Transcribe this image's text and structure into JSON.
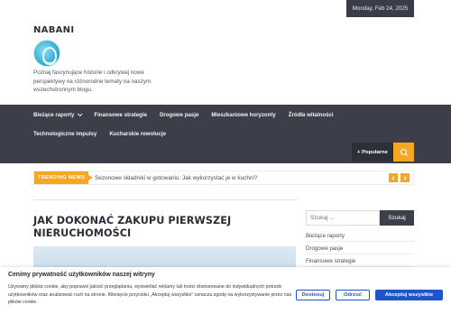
{
  "topbar": {
    "date": "Monday, Feb 24, 2025"
  },
  "header": {
    "site_title": "NABANI",
    "tagline": "Poznaj fascynujące historie i odkrywaj nowe perspektywy na różnorodne tematy na naszym wszechstronnym blogu."
  },
  "nav": {
    "items": [
      {
        "label": "Bieżące raporty"
      },
      {
        "label": "Finansowe strategie"
      },
      {
        "label": "Drogowe pasje"
      },
      {
        "label": "Mieszkaniowe horyzonty"
      },
      {
        "label": "Źródła witalności"
      },
      {
        "label": "Technologiczne impulsy"
      },
      {
        "label": "Kucharskie rewolucje"
      }
    ],
    "popular_label": "+ Popularne"
  },
  "trending": {
    "label": "TRENDING NEWS",
    "headline": "Sezonowe składniki w gotowaniu: Jak wykorzystać je w kuchni?"
  },
  "article": {
    "title": "JAK DOKONAĆ ZAKUPU PIERWSZEJ NIERUCHOMOŚCI"
  },
  "sidebar": {
    "search_placeholder": "Szukaj ...",
    "search_button": "Szukaj",
    "links": [
      {
        "label": "Bieżące raporty"
      },
      {
        "label": "Drogowe pasje"
      },
      {
        "label": "Finansowe strategie"
      }
    ]
  },
  "cookie": {
    "title": "Cenimy prywatność użytkowników naszej witryny",
    "text": "Używamy plików cookie, aby poprawić jakość przeglądania, wyświetlać reklamy lub treści dostosowane do indywidualnych potrzeb użytkowników oraz analizować ruch na stronie. Kliknięcie przycisku „Akceptuj wszystkie” oznacza zgodę na wykorzystywanie przez nas plików cookie.",
    "settings_label": "Dostosuj",
    "reject_label": "Odrzuć",
    "accept_label": "Akceptuj wszystkie",
    "accent_color": "#1f55c9"
  },
  "colors": {
    "nav_bg": "#3c3f4a",
    "accent": "#f5a623"
  }
}
